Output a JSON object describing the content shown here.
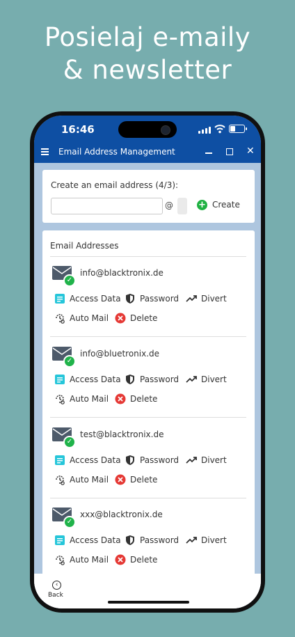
{
  "headline": {
    "line1": "Posielaj e-maily",
    "line2": "& newsletter"
  },
  "status_bar": {
    "time": "16:46"
  },
  "window": {
    "title": "Email Address Management"
  },
  "create": {
    "label": "Create an email address (4/3):",
    "input_value": "",
    "at": "@",
    "button_label": "Create"
  },
  "list": {
    "title": "Email Addresses",
    "entries": [
      {
        "address": "info@blacktronix.de"
      },
      {
        "address": "info@bluetronix.de"
      },
      {
        "address": "test@blacktronix.de"
      },
      {
        "address": "xxx@blacktronix.de"
      }
    ],
    "actions": {
      "access_data": "Access Data",
      "password": "Password",
      "divert": "Divert",
      "auto_mail": "Auto Mail",
      "delete": "Delete"
    }
  },
  "bottom": {
    "back_label": "Back"
  },
  "colors": {
    "background": "#77adae",
    "title_bar": "#0e4fa3",
    "accent_green": "#1fb142",
    "delete_red": "#e53935",
    "access_teal": "#26c6da"
  },
  "icons": [
    "menu-icon",
    "minimize-icon",
    "maximize-icon",
    "close-icon",
    "plus-icon",
    "envelope-icon",
    "check-icon",
    "document-icon",
    "shield-icon",
    "trend-icon",
    "history-icon",
    "delete-icon",
    "back-icon"
  ]
}
